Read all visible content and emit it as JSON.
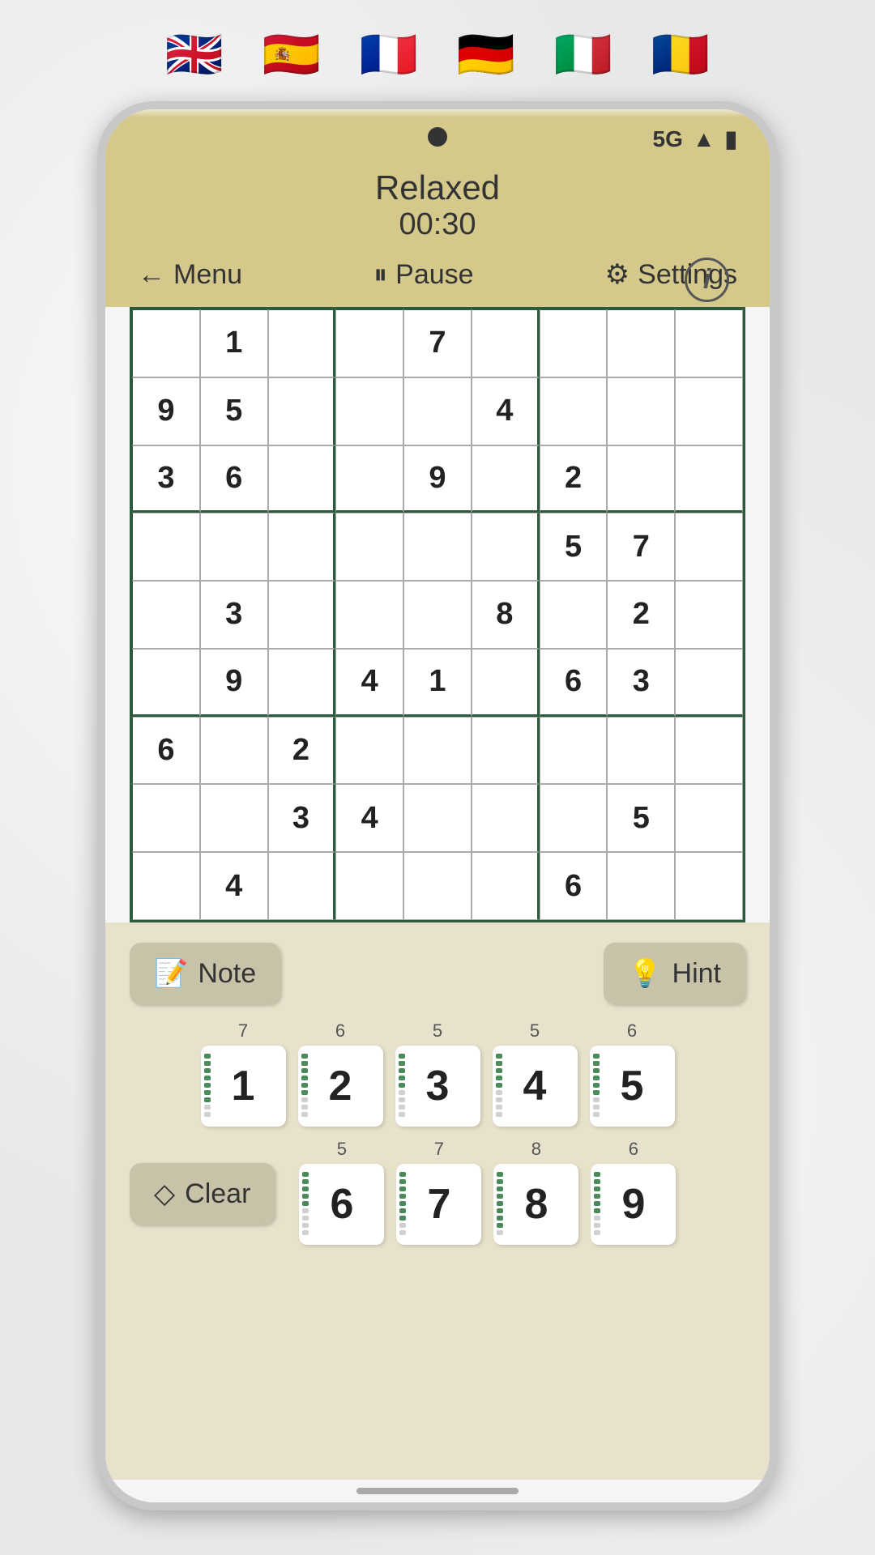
{
  "flags": [
    {
      "name": "uk-flag",
      "emoji": "🇬🇧"
    },
    {
      "name": "spain-flag",
      "emoji": "🇪🇸"
    },
    {
      "name": "france-flag",
      "emoji": "🇫🇷"
    },
    {
      "name": "germany-flag",
      "emoji": "🇩🇪"
    },
    {
      "name": "italy-flag",
      "emoji": "🇮🇹"
    },
    {
      "name": "romania-flag",
      "emoji": "🇷🇴"
    }
  ],
  "status": {
    "signal": "5G",
    "bars": "▲",
    "battery": "🔋"
  },
  "header": {
    "mode": "Relaxed",
    "timer": "00:30",
    "info_label": "i"
  },
  "nav": {
    "menu_label": "Menu",
    "pause_label": "Pause",
    "settings_label": "Settings"
  },
  "grid": [
    [
      "",
      "1",
      "",
      "",
      "7",
      "",
      "",
      "",
      ""
    ],
    [
      "9",
      "5",
      "",
      "",
      "",
      "4",
      "",
      "",
      ""
    ],
    [
      "3",
      "6",
      "",
      "",
      "9",
      "",
      "2",
      "",
      ""
    ],
    [
      "",
      "",
      "",
      "",
      "",
      "",
      "5",
      "7",
      ""
    ],
    [
      "",
      "3",
      "",
      "",
      "",
      "8",
      "",
      "2",
      ""
    ],
    [
      "",
      "9",
      "",
      "4",
      "1",
      "",
      "6",
      "3",
      ""
    ],
    [
      "6",
      "",
      "2",
      "",
      "",
      "",
      "",
      "",
      ""
    ],
    [
      "",
      "",
      "3",
      "4",
      "",
      "",
      "",
      "5",
      ""
    ],
    [
      "",
      "4",
      "",
      "",
      "",
      "",
      "6",
      "",
      ""
    ]
  ],
  "tools": {
    "note_label": "Note",
    "hint_label": "Hint",
    "clear_label": "Clear"
  },
  "numpad": {
    "row1": [
      {
        "digit": "1",
        "top_count": "7",
        "bars": 7
      },
      {
        "digit": "2",
        "top_count": "6",
        "bars": 6
      },
      {
        "digit": "3",
        "top_count": "5",
        "bars": 5
      },
      {
        "digit": "4",
        "top_count": "5",
        "bars": 5
      },
      {
        "digit": "5",
        "top_count": "6",
        "bars": 6
      }
    ],
    "row2": [
      {
        "digit": "6",
        "top_count": "5",
        "bars": 5
      },
      {
        "digit": "7",
        "top_count": "7",
        "bars": 7
      },
      {
        "digit": "8",
        "top_count": "8",
        "bars": 8
      },
      {
        "digit": "9",
        "top_count": "6",
        "bars": 6
      }
    ]
  }
}
